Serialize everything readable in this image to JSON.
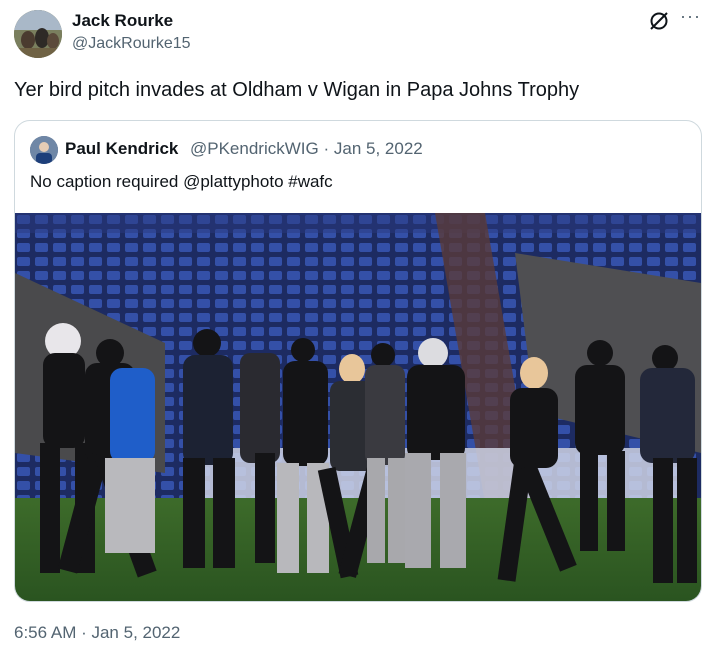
{
  "tweet": {
    "author_name": "Jack Rourke",
    "author_handle": "@JackRourke15",
    "text": "Yer bird pitch invades at Oldham v Wigan in Papa Johns Trophy",
    "timestamp": "6:56 AM · Jan 5, 2022",
    "more_icon": "more-icon",
    "grok_icon": "grok-icon"
  },
  "quote": {
    "author_name": "Paul Kendrick",
    "author_handle": "@PKendrickWIG",
    "separator": "·",
    "date": "Jan 5, 2022",
    "text": "No caption required @plattyphoto #wafc",
    "media": "photo"
  },
  "colors": {
    "text": "#0f1419",
    "secondary": "#536471",
    "border": "#cfd9de"
  }
}
